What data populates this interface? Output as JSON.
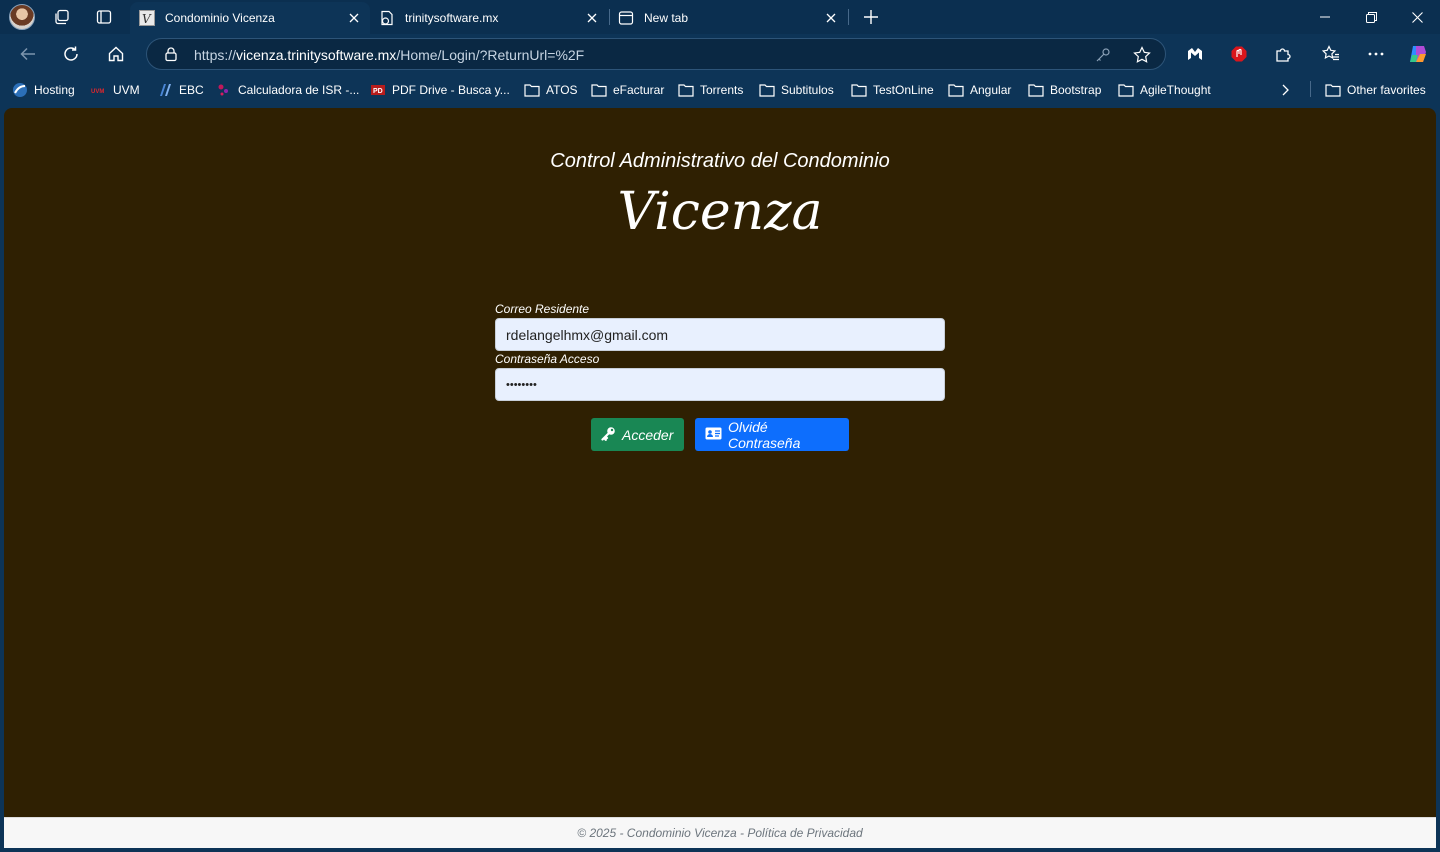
{
  "browser": {
    "tabs": [
      {
        "label": "Condominio Vicenza",
        "active": true
      },
      {
        "label": "trinitysoftware.mx",
        "active": false
      },
      {
        "label": "New tab",
        "active": false
      }
    ],
    "address": {
      "scheme": "https://",
      "host": "vicenza.trinitysoftware.mx",
      "path": "/Home/Login/?ReturnUrl=%2F"
    },
    "bookmarks": [
      {
        "label": "Hosting",
        "icon": "hosting-icon"
      },
      {
        "label": "UVM",
        "icon": "uvm-icon"
      },
      {
        "label": "EBC",
        "icon": "ebc-icon"
      },
      {
        "label": "Calculadora de ISR -...",
        "icon": "calculator-site-icon"
      },
      {
        "label": "PDF Drive - Busca y...",
        "icon": "pdf-drive-icon"
      },
      {
        "label": "ATOS",
        "icon": "folder-icon"
      },
      {
        "label": "eFacturar",
        "icon": "folder-icon"
      },
      {
        "label": "Torrents",
        "icon": "folder-icon"
      },
      {
        "label": "Subtitulos",
        "icon": "folder-icon"
      },
      {
        "label": "TestOnLine",
        "icon": "folder-icon"
      },
      {
        "label": "Angular",
        "icon": "folder-icon"
      },
      {
        "label": "Bootstrap",
        "icon": "folder-icon"
      },
      {
        "label": "AgileThought",
        "icon": "folder-icon"
      }
    ],
    "other_favorites": "Other favorites"
  },
  "page": {
    "subtitle": "Control Administrativo del Condominio",
    "brand": "Vicenza",
    "email_label": "Correo Residente",
    "email_value": "rdelangelhmx@gmail.com",
    "password_label": "Contraseña Acceso",
    "password_value": "••••••••",
    "login_button": "Acceder",
    "forgot_button": "Olvidé Contraseña",
    "footer_text": "© 2025 - Condominio Vicenza - ",
    "footer_link": "Política de Privacidad"
  },
  "colors": {
    "page_background": "#2f2002",
    "login_button": "#198754",
    "forgot_button": "#0d6efd",
    "browser_chrome": "#0d3457"
  }
}
